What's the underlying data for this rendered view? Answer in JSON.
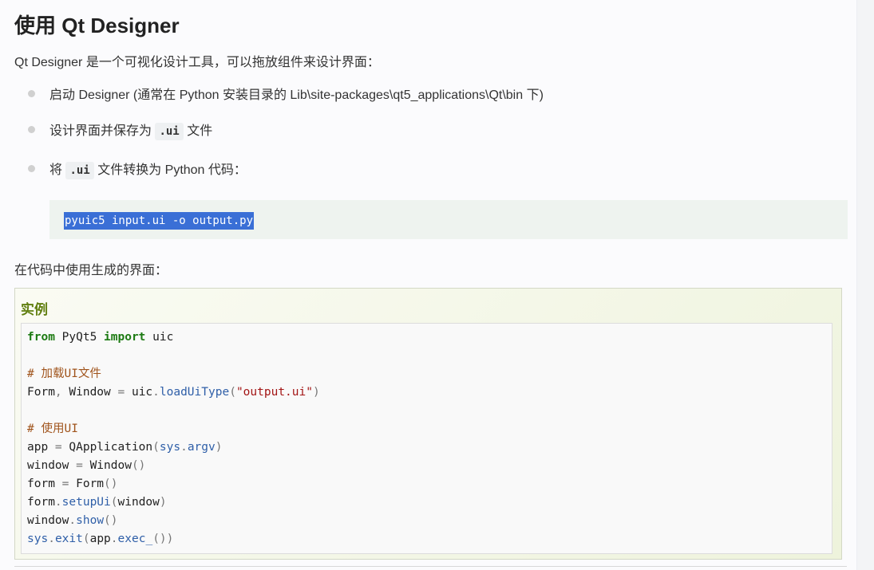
{
  "heading": "使用 Qt Designer",
  "intro": "Qt Designer 是一个可视化设计工具，可以拖放组件来设计界面：",
  "steps": [
    {
      "text": "启动 Designer (通常在 Python 安装目录的 Lib\\site-packages\\qt5_applications\\Qt\\bin 下)"
    },
    {
      "before": "设计界面并保存为 ",
      "code": ".ui",
      "after": " 文件"
    },
    {
      "before": "将 ",
      "code": ".ui",
      "after": " 文件转换为 Python 代码："
    }
  ],
  "command": "pyuic5 input.ui -o output.py",
  "paragraph2": "在代码中使用生成的界面：",
  "example": {
    "title": "实例",
    "code": {
      "line1": {
        "kw1": "from",
        "mod": " PyQt5 ",
        "kw2": "import",
        "name": " uic"
      },
      "comment1": "# 加载UI文件",
      "line3": {
        "lhs": "Form",
        "comma": ",",
        "rhs": " Window ",
        "eq": "=",
        "obj": " uic",
        "dot": ".",
        "fn": "loadUiType",
        "open": "(",
        "str": "\"output.ui\"",
        "close": ")"
      },
      "comment2": "# 使用UI",
      "line5": {
        "lhs": "app ",
        "eq": "=",
        "cls": " QApplication",
        "open": "(",
        "mod": "sys",
        "dot": ".",
        "attr": "argv",
        "close": ")"
      },
      "line6": {
        "lhs": "window ",
        "eq": "=",
        "cls": " Window",
        "parens": "()"
      },
      "line7": {
        "lhs": "form ",
        "eq": "=",
        "cls": " Form",
        "parens": "()"
      },
      "line8": {
        "obj": "form",
        "dot": ".",
        "fn": "setupUi",
        "open": "(",
        "arg": "window",
        "close": ")"
      },
      "line9": {
        "obj": "window",
        "dot": ".",
        "fn": "show",
        "parens": "()"
      },
      "line10": {
        "mod": "sys",
        "dot": ".",
        "fn": "exit",
        "open": "(",
        "obj": "app",
        "dot2": ".",
        "fn2": "exec_",
        "parens": "()",
        "close": ")"
      }
    }
  },
  "colors": {
    "keyword": "#1c7a12",
    "comment": "#a0541c",
    "string": "#a31515",
    "function": "#2f5fa8",
    "example_title": "#617f10",
    "selection": "#3a6fd6"
  }
}
